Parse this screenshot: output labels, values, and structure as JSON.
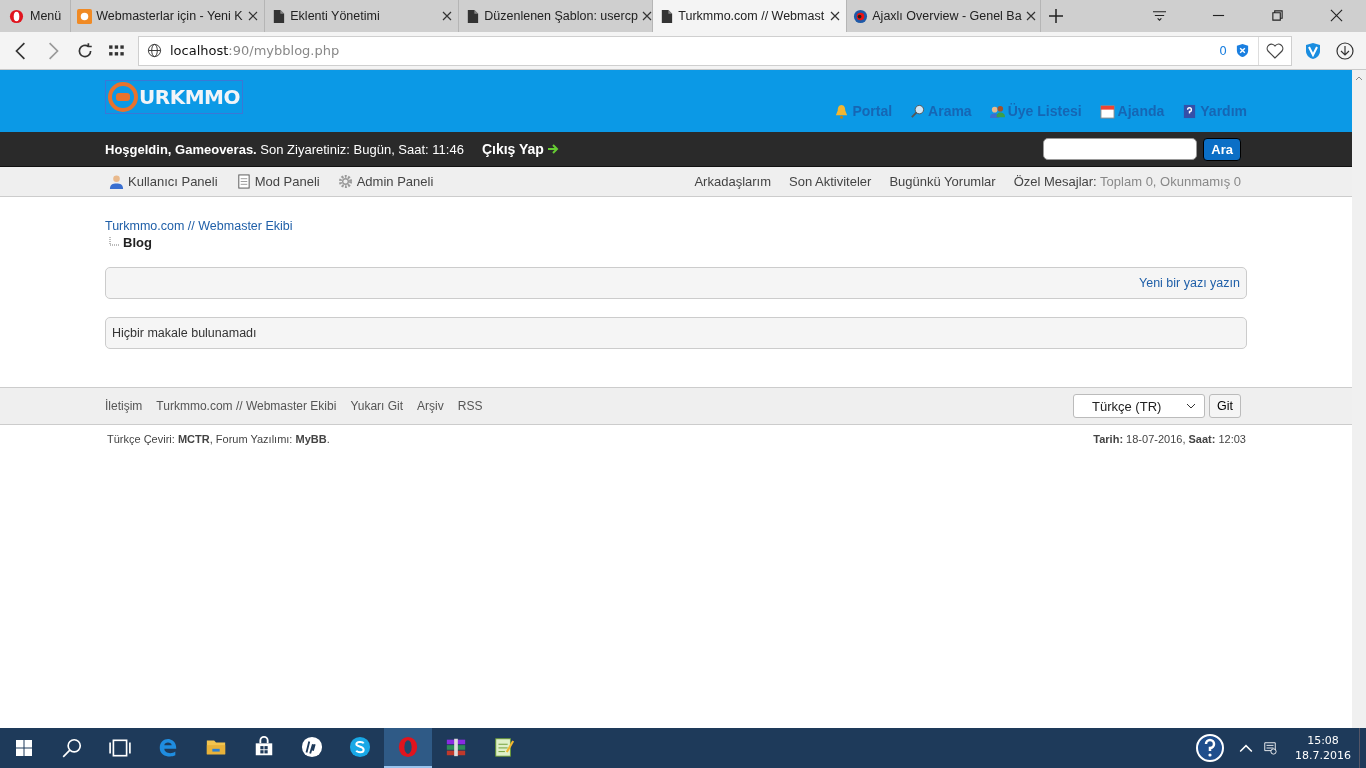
{
  "browser": {
    "menu_label": "Menü",
    "tabs": [
      {
        "title": "Webmasterlar için - Yeni K",
        "kind": "site",
        "selected": false
      },
      {
        "title": "Eklenti Yönetimi",
        "kind": "page",
        "selected": false
      },
      {
        "title": "Düzenlenen Şablon: usercp",
        "kind": "page",
        "selected": false
      },
      {
        "title": "Turkmmo.com // Webmast",
        "kind": "page",
        "selected": true
      },
      {
        "title": "Ajaxlı Overview - Genel Ba",
        "kind": "eye",
        "selected": false
      }
    ],
    "address": {
      "host": "localhost",
      "path": ":90/mybblog.php"
    },
    "blocked_count": "0"
  },
  "header": {
    "logo_text": "URKMMO",
    "links": [
      {
        "label": "Portal",
        "kind": "bell"
      },
      {
        "label": "Arama",
        "kind": "magnifier"
      },
      {
        "label": "Üye Listesi",
        "kind": "people"
      },
      {
        "label": "Ajanda",
        "kind": "calendar"
      },
      {
        "label": "Yardım",
        "kind": "help"
      }
    ]
  },
  "welcome": {
    "greeting": "Hoşgeldin, Gameoveras.",
    "last_visit": "Son Ziyaretiniz: Bugün, Saat: 11:46",
    "logout": "Çıkış Yap",
    "search_button": "Ara"
  },
  "panel": {
    "left": [
      {
        "label": "Kullanıcı Paneli",
        "kind": "user"
      },
      {
        "label": "Mod Paneli",
        "kind": "notebook"
      },
      {
        "label": "Admin Paneli",
        "kind": "gear"
      }
    ],
    "right": [
      "Arkadaşlarım",
      "Son Aktiviteler",
      "Bugünkü Yorumlar"
    ],
    "pm_label": "Özel Mesajlar:",
    "pm_counts": "Toplam 0, Okunmamış 0"
  },
  "breadcrumb": {
    "parent": "Turkmmo.com // Webmaster Ekibi",
    "current": "Blog"
  },
  "new_post_link": "Yeni bir yazı yazın",
  "empty_message": "Hiçbir makale bulunamadı",
  "footer": {
    "links": [
      "İletişim",
      "Turkmmo.com // Webmaster Ekibi",
      "Yukarı Git",
      "Arşiv",
      "RSS"
    ],
    "language": "Türkçe (TR)",
    "go_button": "Git",
    "credits": "Türkçe Çeviri: **MCTR**, Forum Yazılımı: **MyBB**.",
    "datetime": "**Tarih:** 18-07-2016, **Saat:** 12:03"
  },
  "taskbar": {
    "apps": [
      {
        "kind": "edge",
        "selected": false
      },
      {
        "kind": "folder",
        "selected": false
      },
      {
        "kind": "store",
        "selected": false
      },
      {
        "kind": "hp",
        "selected": false
      },
      {
        "kind": "skype",
        "selected": false
      },
      {
        "kind": "opera",
        "selected": true
      },
      {
        "kind": "archive",
        "selected": false
      },
      {
        "kind": "notepad",
        "selected": false
      }
    ],
    "time": "15:08",
    "date": "18.7.2016"
  }
}
